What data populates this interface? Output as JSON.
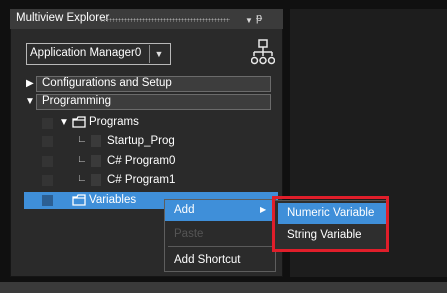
{
  "explorer": {
    "title": "Multiview Explorer",
    "dropdown_icon": "triangle-down",
    "pin_icon": "pin",
    "app_selector": {
      "value": "Application Manager0",
      "button_icon": "triangle-down"
    },
    "hierarchy_icon": "hierarchy"
  },
  "tree": {
    "config": {
      "label": "Configurations and Setup",
      "expander": "▶"
    },
    "programming": {
      "label": "Programming",
      "expander": "▼"
    },
    "programs": {
      "label": "Programs",
      "expander": "▼"
    },
    "items": [
      {
        "label": "Startup_Prog"
      },
      {
        "label": "C# Program0"
      },
      {
        "label": "C# Program1"
      }
    ],
    "variables": {
      "label": "Variables"
    }
  },
  "context_menu": {
    "add": "Add",
    "paste": "Paste",
    "add_shortcut": "Add Shortcut"
  },
  "submenu": {
    "numeric": "Numeric Variable",
    "string": "String Variable"
  },
  "colors": {
    "selection": "#3f8fd9",
    "highlight_box": "#e01e2a",
    "panel": "#2a2a2a"
  }
}
